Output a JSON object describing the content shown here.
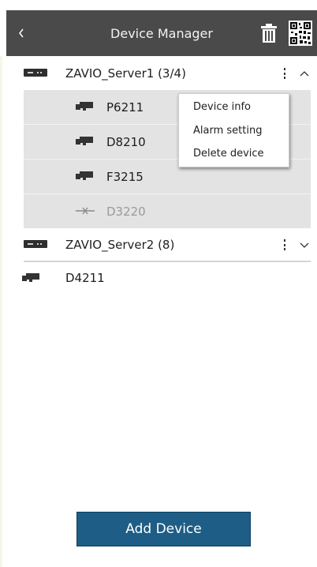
{
  "header": {
    "title": "Device Manager",
    "back_icon": "chevron-left-icon",
    "trash_icon": "trash-icon",
    "qr_icon": "qr-code-icon"
  },
  "servers": [
    {
      "name": "ZAVIO_Server1 (3/4)",
      "expanded": true,
      "cameras": [
        {
          "name": "P6211",
          "status": "online"
        },
        {
          "name": "D8210",
          "status": "online"
        },
        {
          "name": "F3215",
          "status": "online"
        },
        {
          "name": "D3220",
          "status": "offline"
        }
      ]
    },
    {
      "name": "ZAVIO_Server2 (8)",
      "expanded": false,
      "cameras": []
    }
  ],
  "standalone_devices": [
    {
      "name": "D4211"
    }
  ],
  "context_menu": {
    "items": [
      "Device info",
      "Alarm setting",
      "Delete device"
    ]
  },
  "add_device_label": "Add Device",
  "colors": {
    "header_bg": "#4a4a4a",
    "expanded_row_bg": "#e3e3e3",
    "add_button_bg": "#1e5d85"
  }
}
